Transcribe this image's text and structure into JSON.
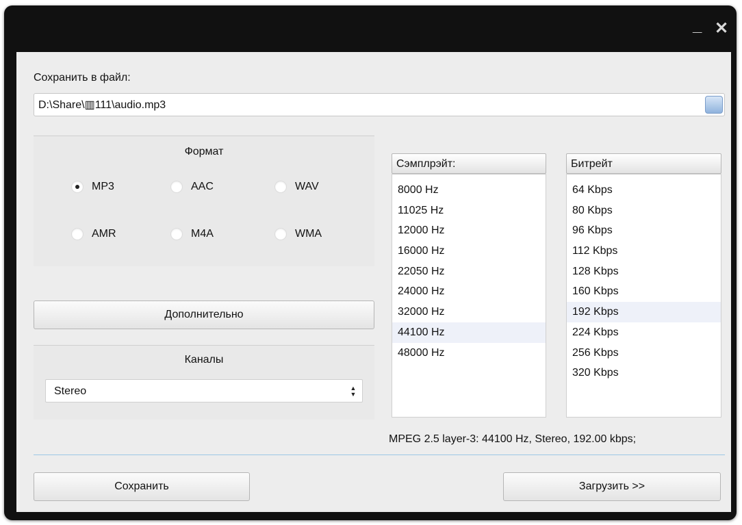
{
  "window": {
    "minimize_glyph": "_",
    "close_glyph": "✕"
  },
  "save_to_file": {
    "label": "Сохранить в файл:",
    "path_value": "D:\\Share\\▥111\\audio.mp3"
  },
  "format": {
    "title": "Формат",
    "options": [
      {
        "label": "MP3",
        "checked": true
      },
      {
        "label": "AAC",
        "checked": false
      },
      {
        "label": "WAV",
        "checked": false
      },
      {
        "label": "AMR",
        "checked": false
      },
      {
        "label": "M4A",
        "checked": false
      },
      {
        "label": "WMA",
        "checked": false
      }
    ]
  },
  "advanced_button": "Дополнительно",
  "channels": {
    "title": "Каналы",
    "selected": "Stereo"
  },
  "samplerate": {
    "header": "Сэмплрэйт:",
    "items": [
      "8000 Hz",
      "11025 Hz",
      "12000 Hz",
      "16000 Hz",
      "22050 Hz",
      "24000 Hz",
      "32000 Hz",
      "44100 Hz",
      "48000 Hz"
    ],
    "selected": "44100 Hz"
  },
  "bitrate": {
    "header": "Битрейт",
    "items": [
      "64 Kbps",
      "80 Kbps",
      "96 Kbps",
      "112 Kbps",
      "128 Kbps",
      "160 Kbps",
      "192 Kbps",
      "224 Kbps",
      "256 Kbps",
      "320 Kbps"
    ],
    "selected": "192 Kbps"
  },
  "status_text": "MPEG 2.5 layer-3: 44100 Hz,  Stereo, 192.00 kbps;",
  "buttons": {
    "save": "Сохранить",
    "load": "Загрузить >>"
  },
  "colors": {
    "title_bar": "#111111",
    "client_bg": "#ededed",
    "selection": "#eef1f9",
    "separator": "#9cc7e6"
  }
}
